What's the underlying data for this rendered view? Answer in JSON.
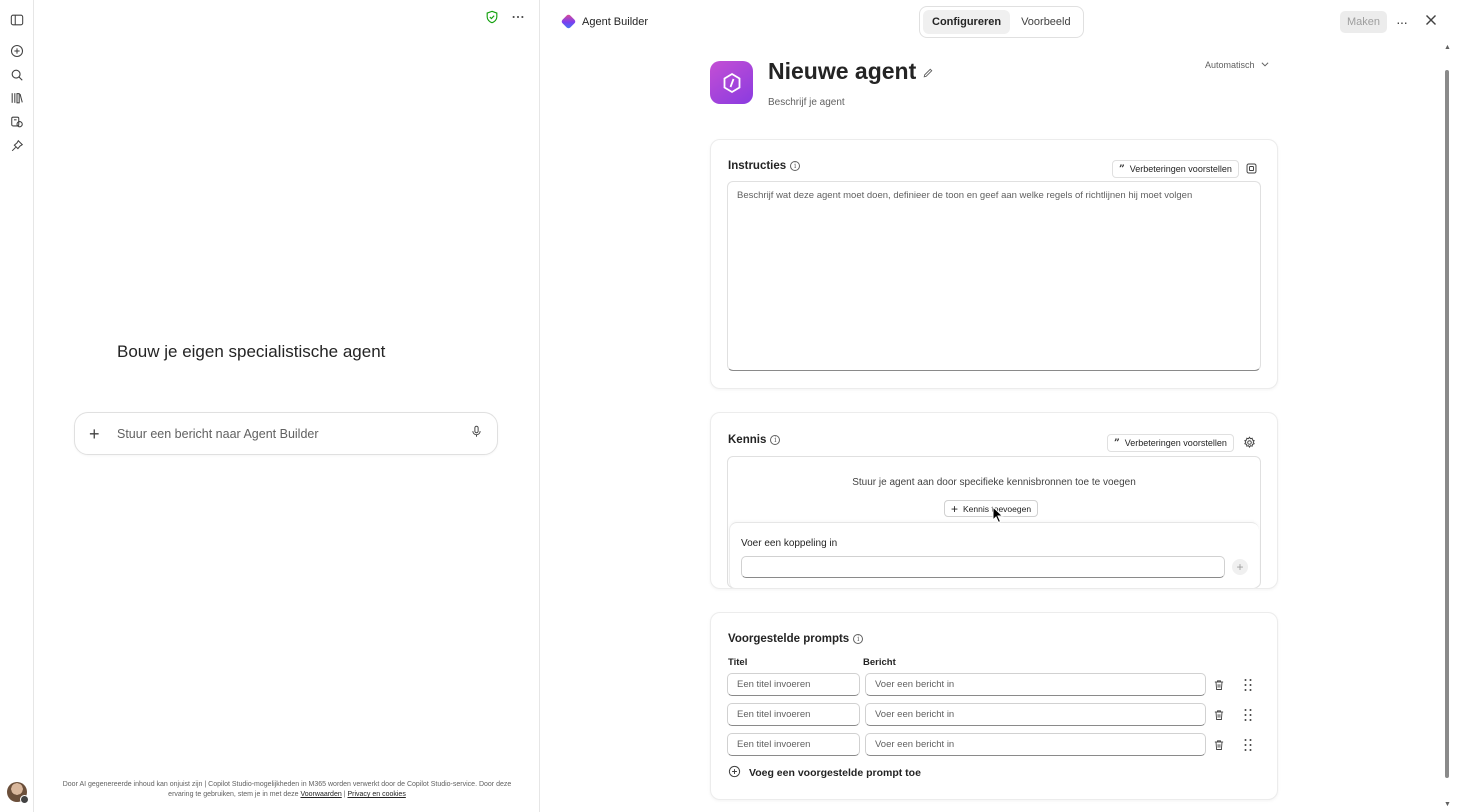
{
  "rail": {
    "icons": [
      "sidebar-toggle-icon",
      "new-chat-icon",
      "search-icon",
      "library-icon",
      "agents-icon",
      "pin-icon"
    ]
  },
  "chat": {
    "heading": "Bouw je eigen specialistische agent",
    "composer_placeholder": "Stuur een bericht naar Agent Builder",
    "footer_text": "Door AI gegenereerde inhoud kan onjuist zijn | Copilot Studio-mogelijkheden in M365 worden verwerkt door de Copilot Studio-service. Door deze ervaring te gebruiken, stem je in met deze",
    "footer_link_terms": "Voorwaarden",
    "footer_separator": " | ",
    "footer_link_privacy": "Privacy en cookies"
  },
  "topbar": {
    "app_title": "Agent Builder",
    "tabs": [
      {
        "label": "Configureren",
        "active": true
      },
      {
        "label": "Voorbeeld",
        "active": false
      }
    ],
    "create_label": "Maken",
    "more_label": "···"
  },
  "agent": {
    "name": "Nieuwe agent",
    "description": "Beschrijf je agent",
    "model_select": "Automatisch"
  },
  "instructions": {
    "title": "Instructies",
    "suggest_label": "Verbeteringen voorstellen",
    "placeholder": "Beschrijf wat deze agent moet doen, definieer de toon en geef aan welke regels of richtlijnen hij moet volgen"
  },
  "knowledge": {
    "title": "Kennis",
    "suggest_label": "Verbeteringen voorstellen",
    "hint": "Stuur je agent aan door specifieke kennisbronnen toe te voegen",
    "add_label": "Kennis toevoegen",
    "link_label": "Voer een koppeling in",
    "link_value": ""
  },
  "prompts": {
    "title": "Voorgestelde prompts",
    "col_title": "Titel",
    "col_message": "Bericht",
    "rows": [
      {
        "title_placeholder": "Een titel invoeren",
        "message_placeholder": "Voer een bericht in"
      },
      {
        "title_placeholder": "Een titel invoeren",
        "message_placeholder": "Voer een bericht in"
      },
      {
        "title_placeholder": "Een titel invoeren",
        "message_placeholder": "Voer een bericht in"
      }
    ],
    "add_label": "Voeg een voorgestelde prompt toe"
  },
  "colors": {
    "accent_purple": "#9b45dc",
    "shield_green": "#13a10e",
    "disabled_bg": "#ececec"
  }
}
